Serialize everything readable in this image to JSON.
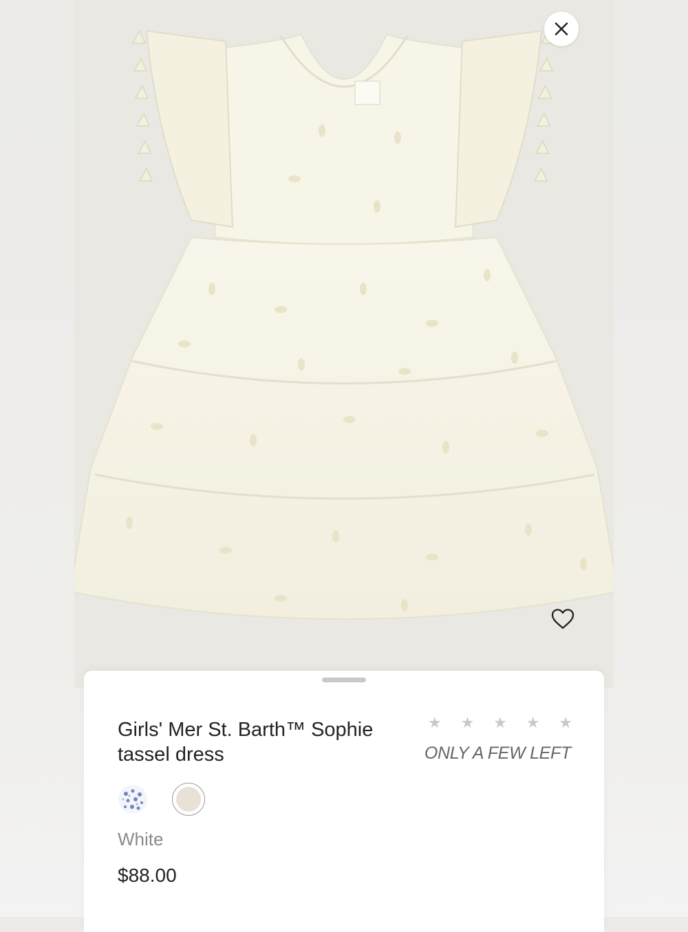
{
  "product": {
    "title": "Girls' Mer St. Barth™ Sophie tassel dress",
    "rating_stars": [
      "★",
      "★",
      "★",
      "★",
      "★"
    ],
    "rating_value": 0,
    "stock_status": "ONLY A FEW LEFT",
    "selected_color": "White",
    "price": "$88.00",
    "swatches": [
      {
        "name": "blue-print",
        "color": "#9fb3d9"
      },
      {
        "name": "white",
        "color": "#e8e1d6",
        "selected": true
      }
    ]
  },
  "icons": {
    "close": "close-icon",
    "favorite": "heart-icon"
  },
  "colors": {
    "dress": "#f6f4e6",
    "background": "#e9e8e3",
    "star_inactive": "#c9c9c9"
  }
}
